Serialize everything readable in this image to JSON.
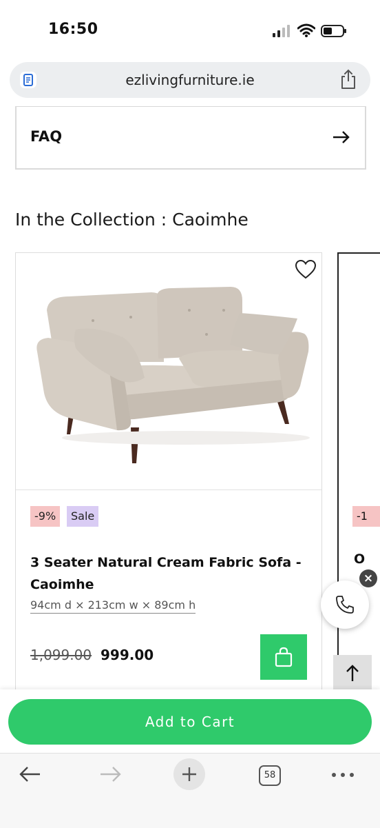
{
  "status_bar": {
    "time": "16:50"
  },
  "browser": {
    "url": "ezlivingfurniture.ie",
    "tab_count": "58"
  },
  "faq": {
    "label": "FAQ"
  },
  "collection": {
    "title": "In the Collection : Caoimhe"
  },
  "product": {
    "badge_discount": "-9%",
    "badge_sale": "Sale",
    "name_line1": "3 Seater Natural Cream Fabric Sofa -",
    "name_line2": "Caoimhe",
    "dimensions": "94cm d × 213cm w × 89cm h",
    "old_price": "1,099.00",
    "price": "999.00"
  },
  "next_product": {
    "badge_discount": "-1",
    "name_start": "O"
  },
  "cart": {
    "add_label": "Add to Cart"
  },
  "colors": {
    "accent_green": "#2fca6b",
    "discount_badge": "#f6c4c4",
    "sale_badge": "#d9ccf4"
  },
  "icons": [
    "reader-icon",
    "share-icon",
    "arrow-right-icon",
    "heart-icon",
    "shopping-bag-icon",
    "phone-icon",
    "close-icon",
    "arrow-up-icon",
    "back-arrow-icon",
    "forward-arrow-icon",
    "plus-icon",
    "more-icon"
  ]
}
